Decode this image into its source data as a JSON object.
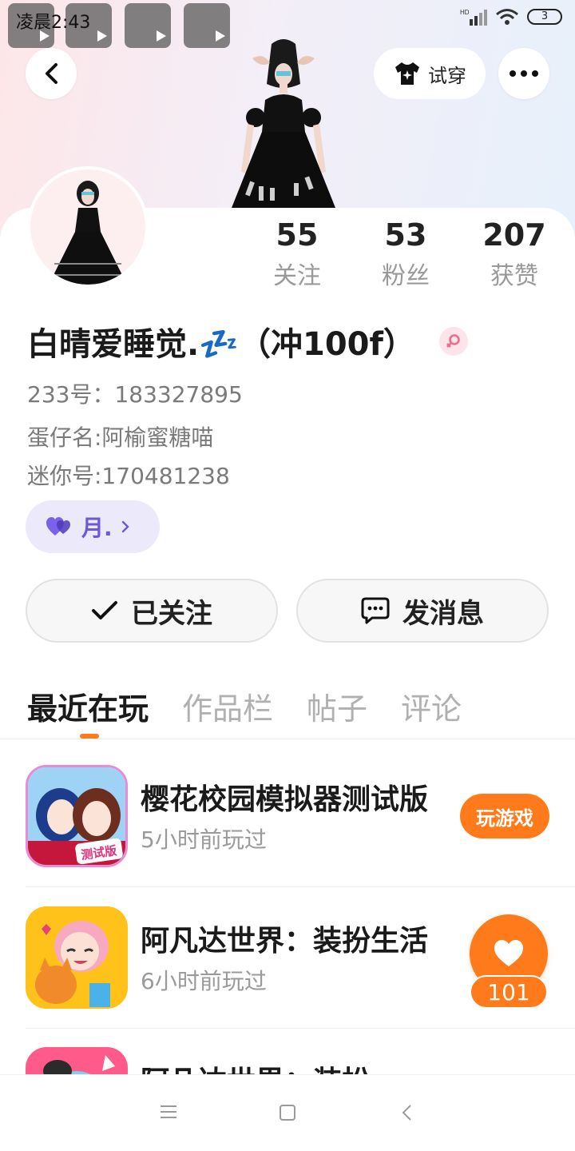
{
  "status_bar": {
    "time": "凌晨2:43",
    "signal_label": "HD",
    "battery": "3"
  },
  "header": {
    "try_on_label": "试穿"
  },
  "stats": [
    {
      "value": "55",
      "label": "关注"
    },
    {
      "value": "53",
      "label": "粉丝"
    },
    {
      "value": "207",
      "label": "获赞"
    }
  ],
  "profile": {
    "name": "白晴爱睡觉.💤（冲100f）",
    "id_line": "233号：183327895",
    "egg_name": "蛋仔名:阿榆蜜糖喵",
    "mini_id": "迷你号:170481238",
    "badge_label": "月.",
    "gender": "female"
  },
  "actions": {
    "followed_label": "已关注",
    "message_label": "发消息"
  },
  "tabs": [
    "最近在玩",
    "作品栏",
    "帖子",
    "评论"
  ],
  "games": [
    {
      "title": "樱花校园模拟器测试版",
      "subtitle": "5小时前玩过",
      "button": "玩游戏",
      "icon_badge": "测试版"
    },
    {
      "title": "阿凡达世界：装扮生活",
      "subtitle": "6小时前玩过"
    },
    {
      "title": "阿凡达世界：装扮"
    }
  ],
  "like_widget": {
    "count": "101"
  },
  "colors": {
    "accent": "#ff7a1a",
    "badge_purple": "#6e58d8"
  }
}
